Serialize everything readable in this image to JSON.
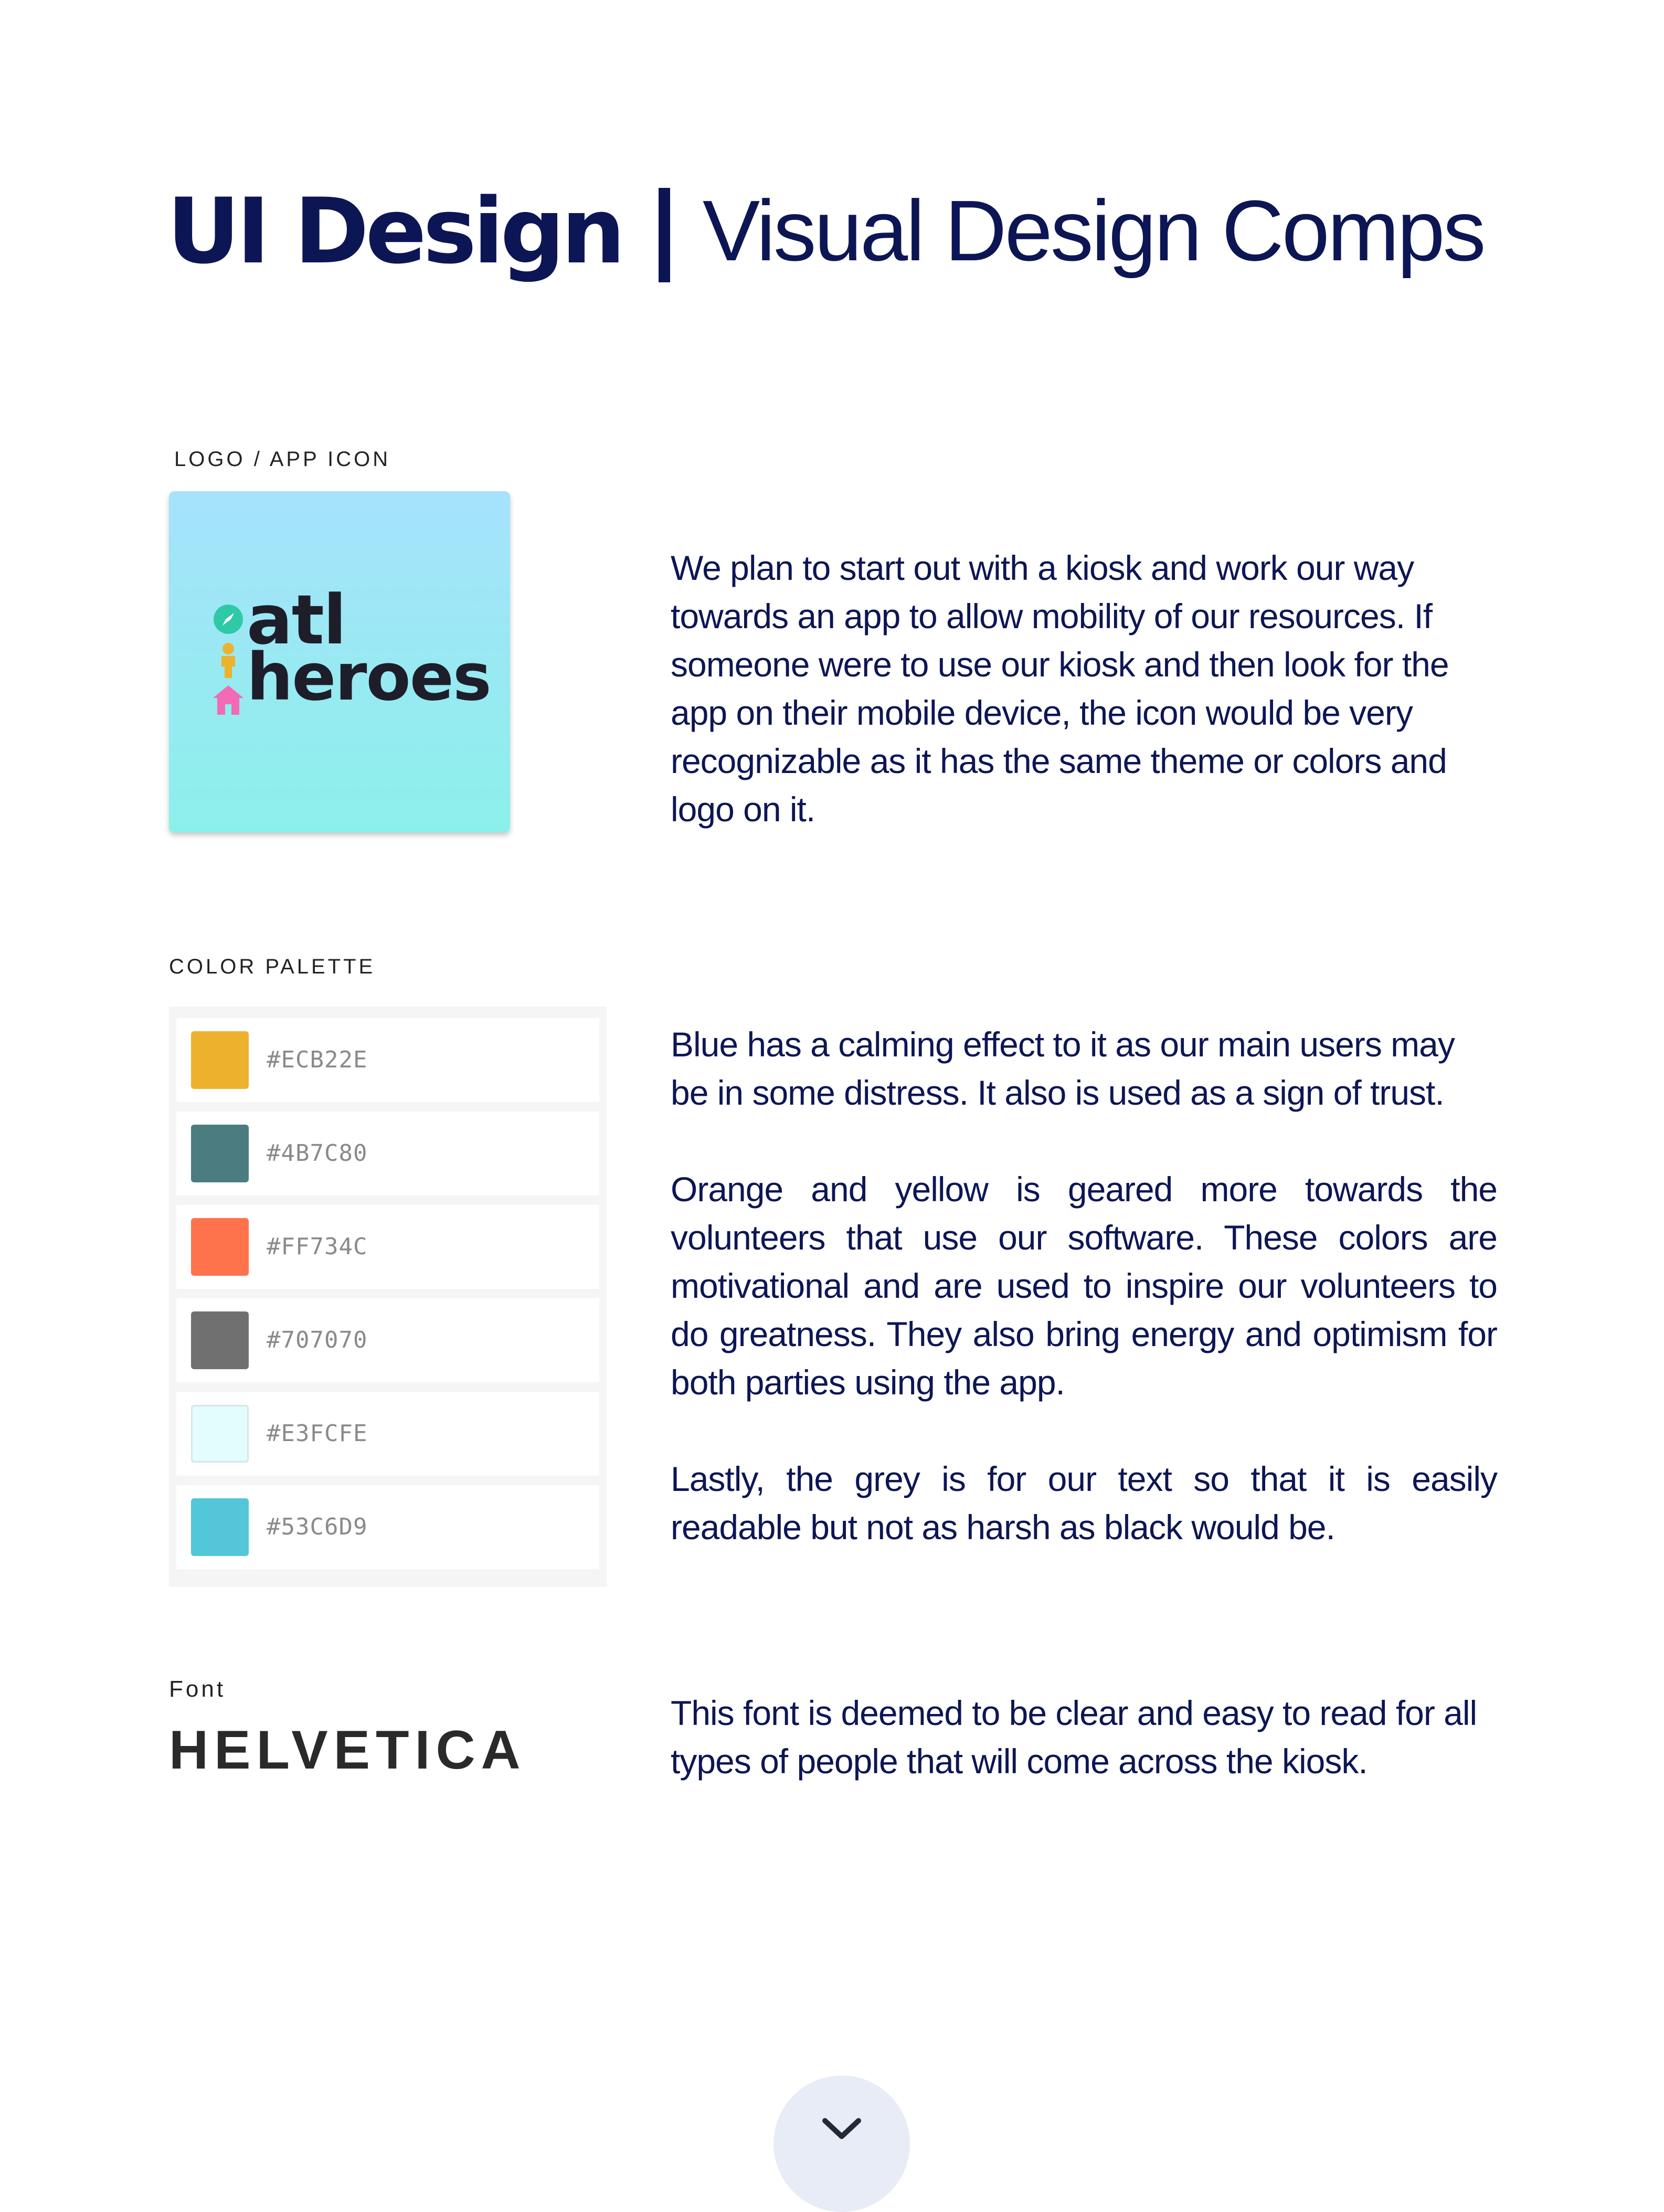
{
  "header": {
    "title_bold": "UI Design",
    "title_light": "Visual Design Comps"
  },
  "logo_section": {
    "label": "LOGO / APP ICON",
    "logo_line_1": "atl",
    "logo_line_2": "heroes",
    "description": "We plan to start out with a kiosk and work our way towards an app to allow mobility of our resources. If someone were to use our kiosk and then look for the app on their mobile device, the icon would be very recognizable as it has the same theme or colors and logo on it."
  },
  "palette_section": {
    "label": "COLOR PALETTE",
    "colors": [
      {
        "hex": "#ECB22E",
        "label": "#ECB22E"
      },
      {
        "hex": "#4B7C80",
        "label": "#4B7C80"
      },
      {
        "hex": "#FF734C",
        "label": "#FF734C"
      },
      {
        "hex": "#707070",
        "label": "#707070"
      },
      {
        "hex": "#E3FCFE",
        "label": "#E3FCFE"
      },
      {
        "hex": "#53C6D9",
        "label": "#53C6D9"
      }
    ],
    "paragraph_1": "Blue has a calming effect to  it as our main users may be in some distress. It also is used as a sign of trust.",
    "paragraph_2": "Orange and yellow is geared more towards the volunteers that use our software. These colors are motivational and are used to inspire our volunteers to do greatness. They also bring energy and optimism for both parties using the app.",
    "paragraph_3": "Lastly, the grey is for our text so that it is easily readable but not as harsh as black would be."
  },
  "font_section": {
    "label": "Font",
    "font_name": "HELVETICA",
    "description": "This font is deemed to be clear and easy to read for all types of people that will come across the kiosk."
  },
  "scroll_button": {
    "icon": "chevron-down-icon"
  }
}
